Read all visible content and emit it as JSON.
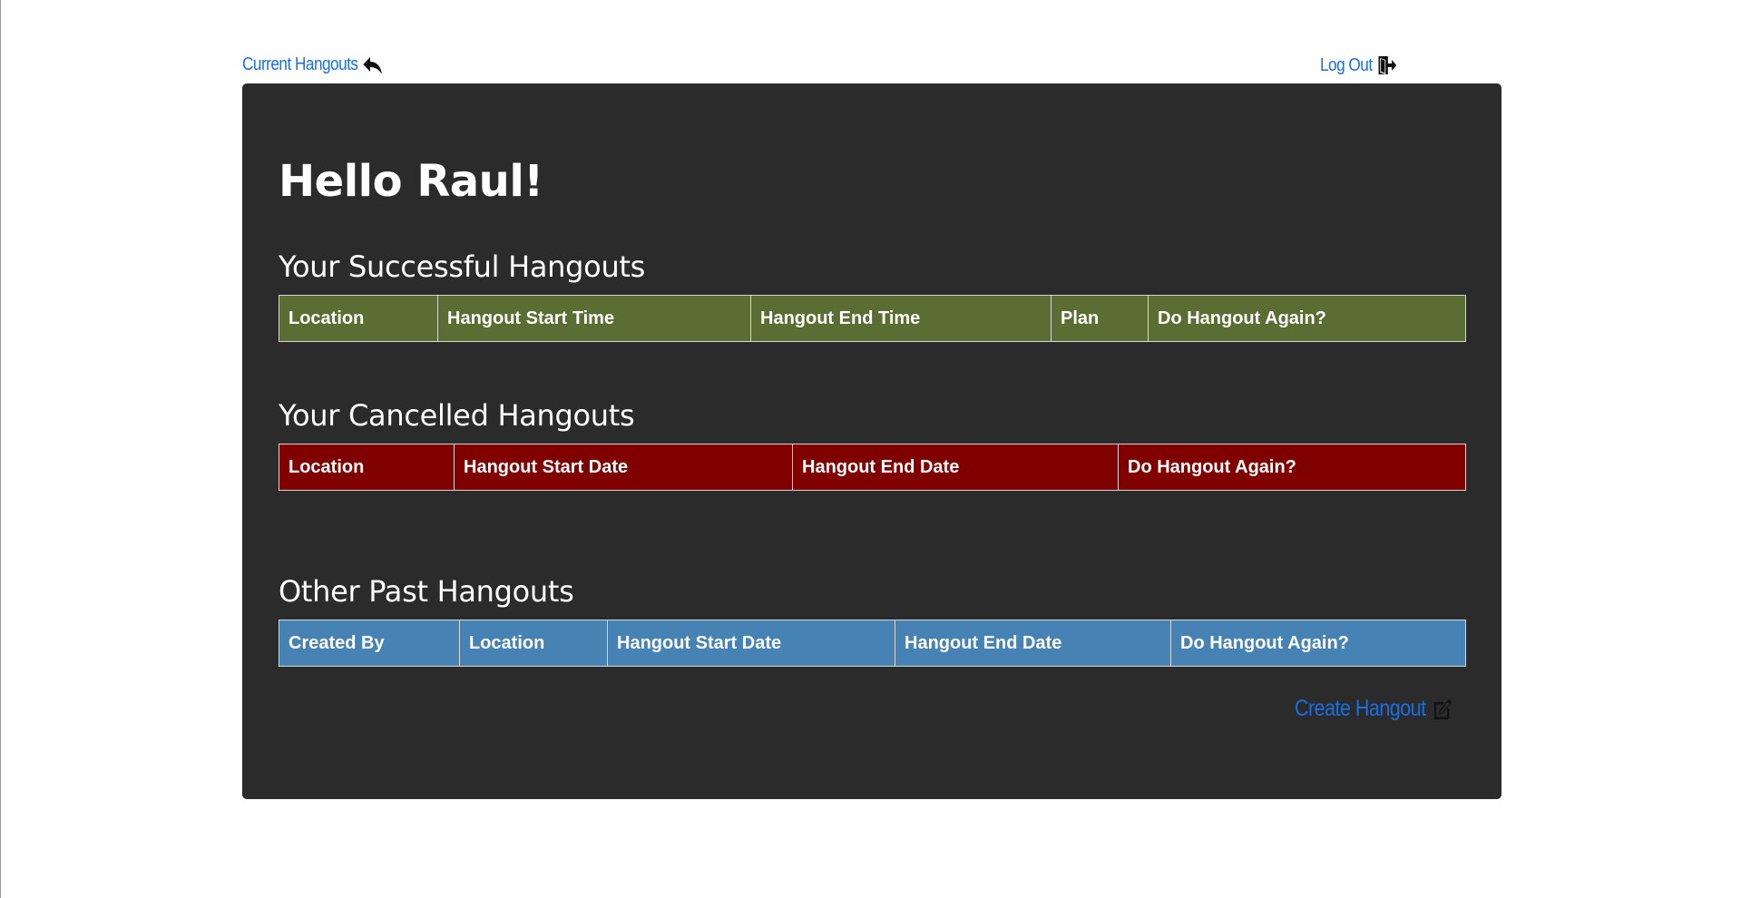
{
  "nav": {
    "current_hangouts": "Current Hangouts",
    "current_hangouts_icon": "reply-arrow-icon",
    "logout": "Log Out",
    "logout_icon": "door-exit-icon"
  },
  "greeting": "Hello Raul!",
  "successful": {
    "title": "Your Successful Hangouts",
    "columns": [
      "Location",
      "Hangout Start Time",
      "Hangout End Time",
      "Plan",
      "Do Hangout Again?"
    ],
    "color": "#5a6e33"
  },
  "cancelled": {
    "title": "Your Cancelled Hangouts",
    "columns": [
      "Location",
      "Hangout Start Date",
      "Hangout End Date",
      "Do Hangout Again?"
    ],
    "color": "#800000"
  },
  "other": {
    "title": "Other Past Hangouts",
    "columns": [
      "Created By",
      "Location",
      "Hangout Start Date",
      "Hangout End Date",
      "Do Hangout Again?"
    ],
    "color": "#4682b4"
  },
  "create": {
    "label": "Create Hangout",
    "icon": "edit-square-icon"
  },
  "colors": {
    "link": "#1a6fe0",
    "card_background": "#2b2b2b",
    "page_background": "#ffffff"
  }
}
